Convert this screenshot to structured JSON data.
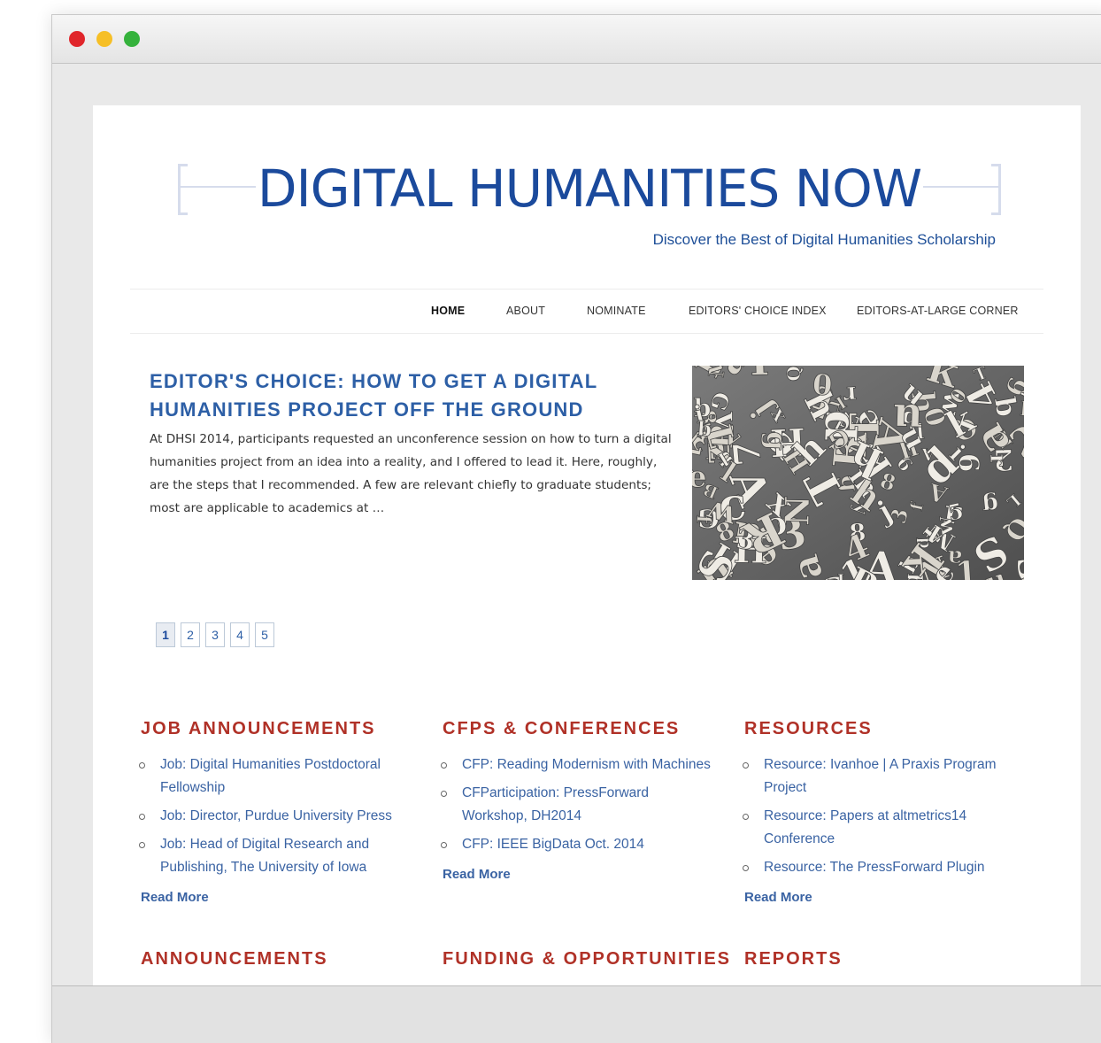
{
  "browser": {
    "buttons": [
      "close",
      "minimize",
      "zoom"
    ]
  },
  "site": {
    "logo": "DIGITAL HUMANITIES NOW",
    "tagline": "Discover the Best of Digital Humanities Scholarship"
  },
  "nav": {
    "items": [
      {
        "label": "HOME",
        "active": true
      },
      {
        "label": "ABOUT"
      },
      {
        "label": "NOMINATE"
      },
      {
        "label": "EDITORS' CHOICE INDEX"
      },
      {
        "label": "EDITORS-AT-LARGE CORNER"
      }
    ]
  },
  "feature": {
    "title": "EDITOR'S CHOICE: HOW TO GET A DIGITAL HUMANITIES PROJECT OFF THE GROUND",
    "excerpt": "At DHSI 2014, participants requested an unconference session on how to turn a digital humanities project from an idea into a reality, and I offered to lead it. Here, roughly, are the steps that I recommended. A few are relevant chiefly to graduate students; most are applicable to academics at …",
    "image_icon": "scattered-letters-image"
  },
  "pagination": {
    "pages": [
      "1",
      "2",
      "3",
      "4",
      "5"
    ],
    "current": "1"
  },
  "sections": [
    {
      "heading": "JOB ANNOUNCEMENTS",
      "items": [
        "Job: Digital Humanities Postdoctoral Fellowship",
        "Job: Director, Purdue University Press",
        "Job: Head of Digital Research and Publishing, The University of Iowa"
      ],
      "read_more": "Read More"
    },
    {
      "heading": "CFPS & CONFERENCES",
      "items": [
        "CFP: Reading Modernism with Machines",
        "CFParticipation: PressForward Workshop, DH2014",
        "CFP: IEEE BigData Oct. 2014"
      ],
      "read_more": "Read More"
    },
    {
      "heading": "RESOURCES",
      "items": [
        "Resource: Ivanhoe | A Praxis Program Project",
        "Resource: Papers at altmetrics14 Conference",
        "Resource: The PressForward Plugin"
      ],
      "read_more": "Read More"
    }
  ],
  "lower_headings": [
    "ANNOUNCEMENTS",
    "FUNDING & OPPORTUNITIES",
    "REPORTS"
  ],
  "colors": {
    "logo_blue": "#1b4a9c",
    "title_blue": "#2d5fa6",
    "section_red": "#b03127",
    "link_blue": "#3a63a3"
  }
}
